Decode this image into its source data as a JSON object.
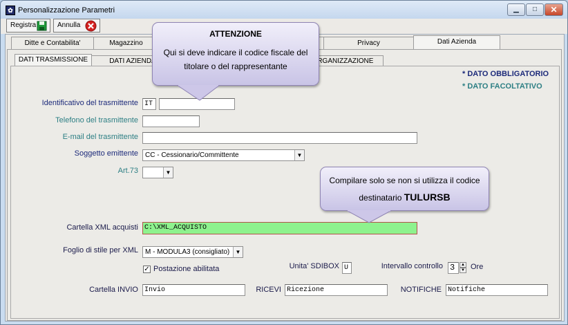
{
  "window": {
    "title": "Personalizzazione Parametri",
    "minimize": "▁",
    "maximize": "□",
    "close": "✕"
  },
  "toolbar": {
    "save_label": "Registra",
    "cancel_label": "Annulla"
  },
  "tabs": [
    "Ditte e Contabilita'",
    "Magazzino",
    "",
    "Privacy",
    "Dati Azienda"
  ],
  "subtabs": [
    "DATI TRASMISSIONE",
    "DATI AZIENDA",
    "ORGANIZZAZIONE"
  ],
  "legend": {
    "required": "* DATO OBBLIGATORIO",
    "optional": "* DATO FACOLTATIVO",
    "required_color": "#1c2a7a",
    "optional_color": "#2d8f84"
  },
  "callouts": {
    "attention_title": "ATTENZIONE",
    "attention_body": "Qui si deve indicare il codice fiscale del titolare o del rappresentante",
    "xml_note": "Compilare solo se non si utilizza il codice destinatario",
    "xml_code": "TULURSB"
  },
  "form": {
    "id_label": "Identificativo del trasmittente",
    "id_country": "IT",
    "id_value": "",
    "phone_label": "Telefono del trasmittente",
    "phone_value": "",
    "email_label": "E-mail del trasmittente",
    "email_value": "",
    "subject_label": "Soggetto emittente",
    "subject_value": "CC - Cessionario/Committente",
    "art73_label": "Art.73",
    "art73_value": "",
    "xml_folder_label": "Cartella XML acquisti",
    "xml_folder_value": "C:\\XML_ACQUISTO",
    "stylesheet_label": "Foglio di stile per XML",
    "stylesheet_value": "M - MODULA3 (consigliato)",
    "station_enabled_label": "Postazione abilitata",
    "station_enabled": true,
    "sdibox_label": "Unita' SDIBOX",
    "sdibox_value": "U",
    "interval_label": "Intervallo controllo",
    "interval_value": "3",
    "interval_unit": "Ore",
    "send_folder_label": "Cartella INVIO",
    "send_folder_value": "Invio",
    "receive_label": "RICEVI",
    "receive_value": "Ricezione",
    "notify_label": "NOTIFICHE",
    "notify_value": "Notifiche"
  }
}
